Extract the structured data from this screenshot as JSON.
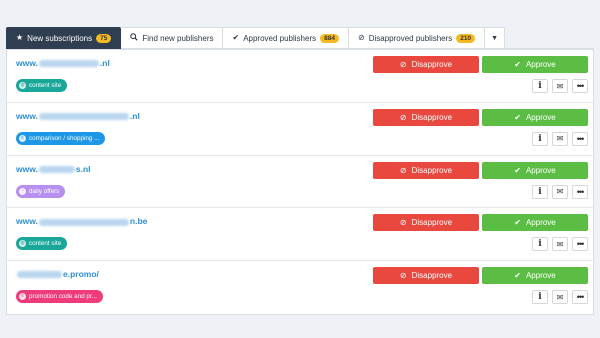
{
  "tabs": [
    {
      "label": "New subscriptions",
      "icon": "star-icon",
      "count": "75"
    },
    {
      "label": "Find new publishers",
      "icon": "search-icon"
    },
    {
      "label": "Approved publishers",
      "icon": "check-icon",
      "count": "884"
    },
    {
      "label": "Disapproved publishers",
      "icon": "ban-icon",
      "count": "210"
    }
  ],
  "actions": {
    "disapprove_label": "Disapprove",
    "approve_label": "Approve"
  },
  "colors": {
    "disapprove": "#e8483e",
    "approve": "#5bbd44",
    "active_tab": "#2f3e50",
    "link": "#2d8fd5",
    "badge": "#f5b921"
  },
  "rows": [
    {
      "site_prefix": "www.",
      "site_suffix": ".nl",
      "tag": "content site",
      "tag_icon": "globe-icon",
      "tag_color": "#1aa79a"
    },
    {
      "site_prefix": "www.",
      "site_suffix": ".nl",
      "tag": "comparison / shopping ...",
      "tag_icon": "list-icon",
      "tag_color": "#1d98e6"
    },
    {
      "site_prefix": "www.",
      "site_suffix": "s.nl",
      "tag": "daily offers",
      "tag_icon": "clock-icon",
      "tag_color": "#b78ff0"
    },
    {
      "site_prefix": "www.",
      "site_suffix": "n.be",
      "tag": "content site",
      "tag_icon": "globe-icon",
      "tag_color": "#1aa79a"
    },
    {
      "site_prefix": "",
      "site_suffix": "e.promo/",
      "tag": "promotion code and pr...",
      "tag_icon": "list-icon",
      "tag_color": "#ef3b7c"
    }
  ]
}
